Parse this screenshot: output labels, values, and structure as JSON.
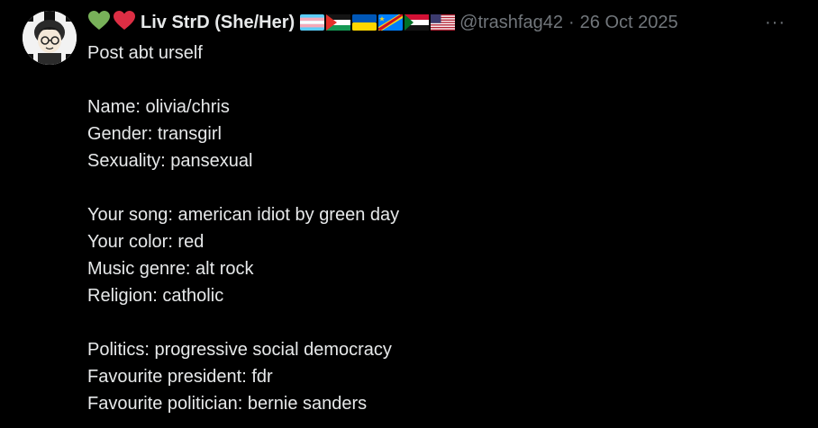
{
  "tweet": {
    "name_emojis": [
      "green-heart",
      "red-heart"
    ],
    "display_name": "Liv StrD (She/Her)",
    "flags": [
      "transgender-flag",
      "palestine-flag",
      "ukraine-flag",
      "congo-flag",
      "sudan-flag",
      "usa-flag"
    ],
    "handle": "@trashfag42",
    "separator": "·",
    "date": "26 Oct 2025",
    "more_label": "···",
    "lines": [
      "Post abt urself",
      "",
      "Name: olivia/chris",
      "Gender: transgirl",
      "Sexuality: pansexual",
      "",
      "Your song: american idiot by green day",
      "Your color: red",
      "Music genre: alt rock",
      "Religion: catholic",
      "",
      "Politics: progressive social democracy",
      "Favourite president: fdr",
      "Favourite politician: bernie sanders"
    ]
  },
  "colors": {
    "background": "#000000",
    "text": "#e7e9ea",
    "secondary": "#71767b"
  }
}
